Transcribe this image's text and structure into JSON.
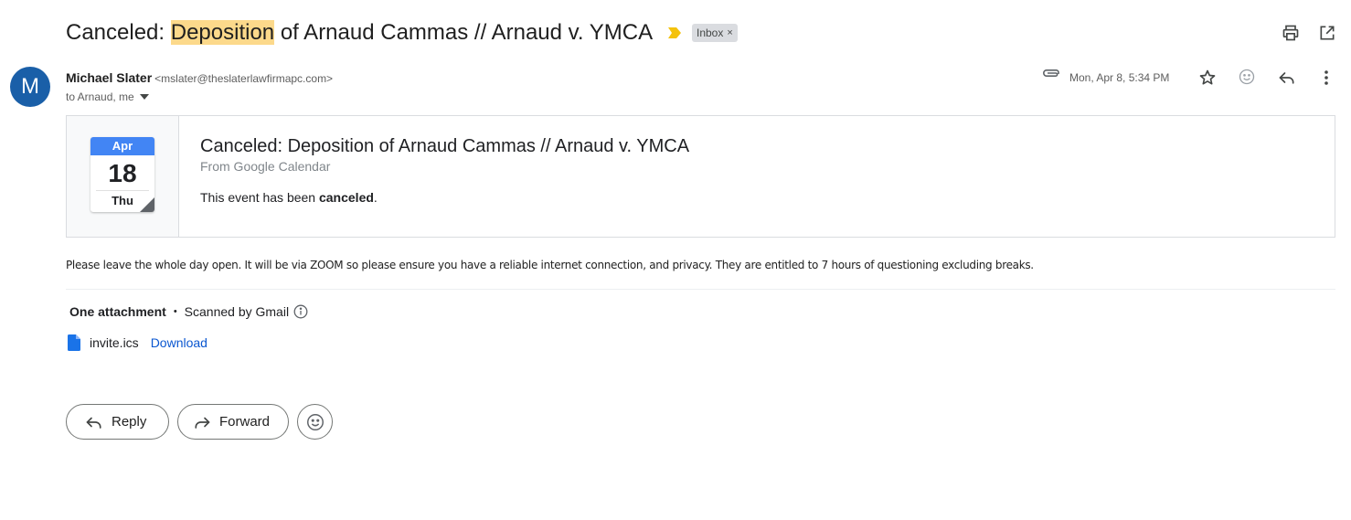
{
  "email": {
    "subject_prefix": "Canceled: ",
    "subject_highlight": "Deposition",
    "subject_rest": " of Arnaud Cammas // Arnaud v. YMCA",
    "label_chip": "Inbox",
    "label_remove": "×",
    "sender_initial": "M",
    "sender_name": "Michael Slater",
    "sender_email": "<mslater@theslaterlawfirmapc.com>",
    "recipients": "to Arnaud, me",
    "date": "Mon, Apr 8, 5:34 PM",
    "body": "Please leave the whole day open. It will be via ZOOM so please ensure you have a reliable internet connection, and privacy. They are entitled to 7 hours of questioning excluding breaks."
  },
  "invite": {
    "month": "Apr",
    "day": "18",
    "weekday": "Thu",
    "title": "Canceled: Deposition of Arnaud Cammas // Arnaud v. YMCA",
    "source": "From Google Calendar",
    "status_prefix": "This event has been ",
    "status_word": "canceled",
    "status_suffix": "."
  },
  "attachments": {
    "header": "One attachment",
    "separator": "•",
    "scanned_label": "Scanned by Gmail",
    "files": [
      {
        "name": "invite.ics",
        "action": "Download",
        "icon": "file-icon"
      }
    ]
  },
  "actions": {
    "reply_label": "Reply",
    "forward_label": "Forward"
  },
  "colors": {
    "avatar": "#1a5fa8",
    "highlight": "#fcd98b",
    "importance_marker": "#f4c20d",
    "calendar_header": "#4285f4",
    "link": "#0b57d0"
  }
}
